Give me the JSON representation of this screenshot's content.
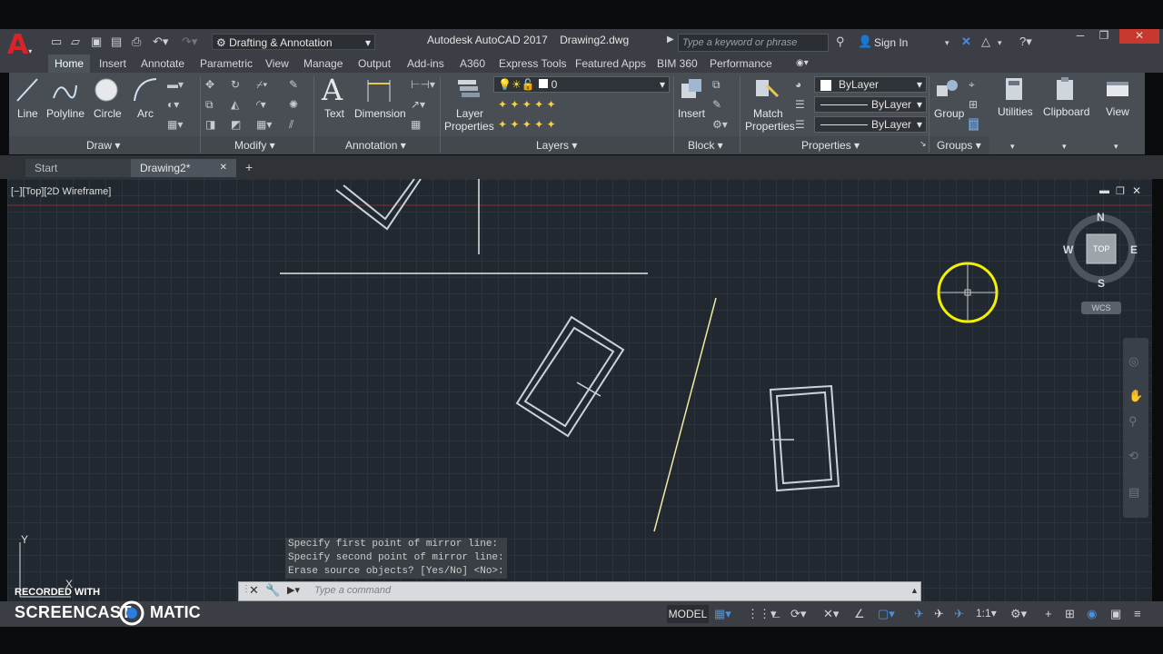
{
  "titlebar": {
    "workspace": "Drafting & Annotation",
    "app_title": "Autodesk AutoCAD 2017",
    "file_title": "Drawing2.dwg",
    "search_placeholder": "Type a keyword or phrase",
    "sign_in": "Sign In"
  },
  "ribbon_tabs": [
    "Home",
    "Insert",
    "Annotate",
    "Parametric",
    "View",
    "Manage",
    "Output",
    "Add-ins",
    "A360",
    "Express Tools",
    "Featured Apps",
    "BIM 360",
    "Performance"
  ],
  "ribbon": {
    "draw": {
      "line": "Line",
      "polyline": "Polyline",
      "circle": "Circle",
      "arc": "Arc",
      "panel": "Draw"
    },
    "modify": {
      "panel": "Modify"
    },
    "annotation": {
      "text": "Text",
      "dimension": "Dimension",
      "panel": "Annotation"
    },
    "layers": {
      "layer_properties_1": "Layer",
      "layer_properties_2": "Properties",
      "current_layer": "0",
      "panel": "Layers"
    },
    "block": {
      "insert": "Insert",
      "panel": "Block"
    },
    "properties": {
      "match_1": "Match",
      "match_2": "Properties",
      "color": "ByLayer",
      "linetype": "ByLayer",
      "lineweight": "ByLayer",
      "panel": "Properties"
    },
    "groups": {
      "group": "Group",
      "panel": "Groups"
    },
    "utilities": "Utilities",
    "clipboard": "Clipboard",
    "view": "View"
  },
  "file_tabs": {
    "start": "Start",
    "drawing": "Drawing2*"
  },
  "viewport": {
    "label": "[−][Top][2D Wireframe]",
    "compass": {
      "n": "N",
      "s": "S",
      "e": "E",
      "w": "W",
      "top": "TOP",
      "wcs": "WCS"
    }
  },
  "command": {
    "history": [
      "Specify first point of mirror line:",
      "Specify second point of mirror line:",
      "Erase source objects? [Yes/No] <No>:"
    ],
    "placeholder": "Type a command"
  },
  "statusbar": {
    "model": "MODEL",
    "scale": "1:1"
  },
  "watermark": {
    "line1": "RECORDED WITH",
    "line2": "SCREENCAST",
    "line3": "MATIC"
  },
  "ucs": {
    "y": "Y",
    "x": "X"
  }
}
